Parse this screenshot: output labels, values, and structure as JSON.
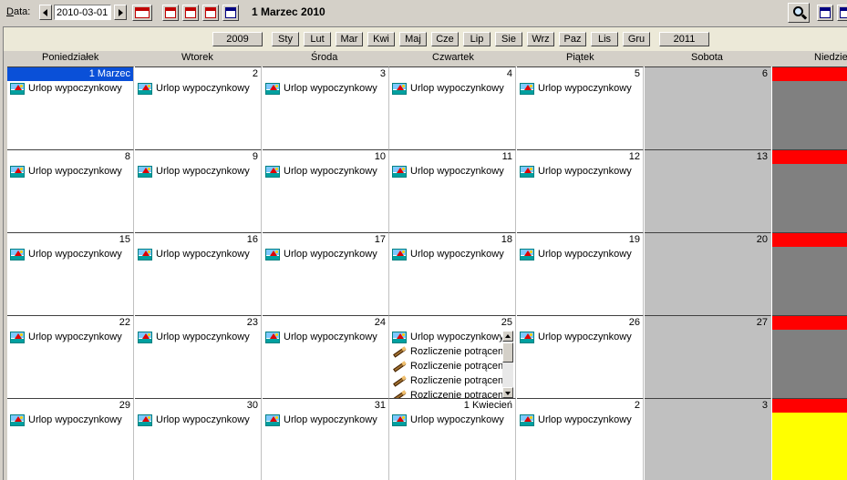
{
  "toolbar": {
    "date_label_underlined": "D",
    "date_label_rest": "ata:",
    "date_value": "2010-03-01",
    "title": "1 Marzec 2010",
    "view_icons": [
      "month-view-icon",
      "day-view-icon",
      "week-view-icon",
      "month-31-view-icon",
      "list-view-icon"
    ]
  },
  "nav": {
    "prev_year": "2009",
    "next_year": "2011",
    "months": [
      "Sty",
      "Lut",
      "Mar",
      "Kwi",
      "Maj",
      "Cze",
      "Lip",
      "Sie",
      "Wrz",
      "Paz",
      "Lis",
      "Gru"
    ]
  },
  "weekdays": [
    "Poniedziałek",
    "Wtorek",
    "Środa",
    "Czwartek",
    "Piątek",
    "Sobota",
    "Niedzie"
  ],
  "event_labels": {
    "vacation": "Urlop wypoczynkowy",
    "deduction": "Rozliczenie potrącen"
  },
  "days": {
    "r0": [
      "1 Marzec",
      "2",
      "3",
      "4",
      "5",
      "6",
      ""
    ],
    "r1": [
      "8",
      "9",
      "10",
      "11",
      "12",
      "13",
      ""
    ],
    "r2": [
      "15",
      "16",
      "17",
      "18",
      "19",
      "20",
      ""
    ],
    "r3": [
      "22",
      "23",
      "24",
      "25",
      "26",
      "27",
      ""
    ],
    "r4": [
      "29",
      "30",
      "31",
      "1 Kwiecień",
      "2",
      "3",
      ""
    ]
  },
  "colors": {
    "weekday_bg": "#ffffff",
    "saturday_bg": "#c0c0c0",
    "sunday_bg": "#808080",
    "sunday_header": "#ff0000",
    "highlight_sunday": "#ffff00",
    "selected_day": "#0a50d8"
  }
}
